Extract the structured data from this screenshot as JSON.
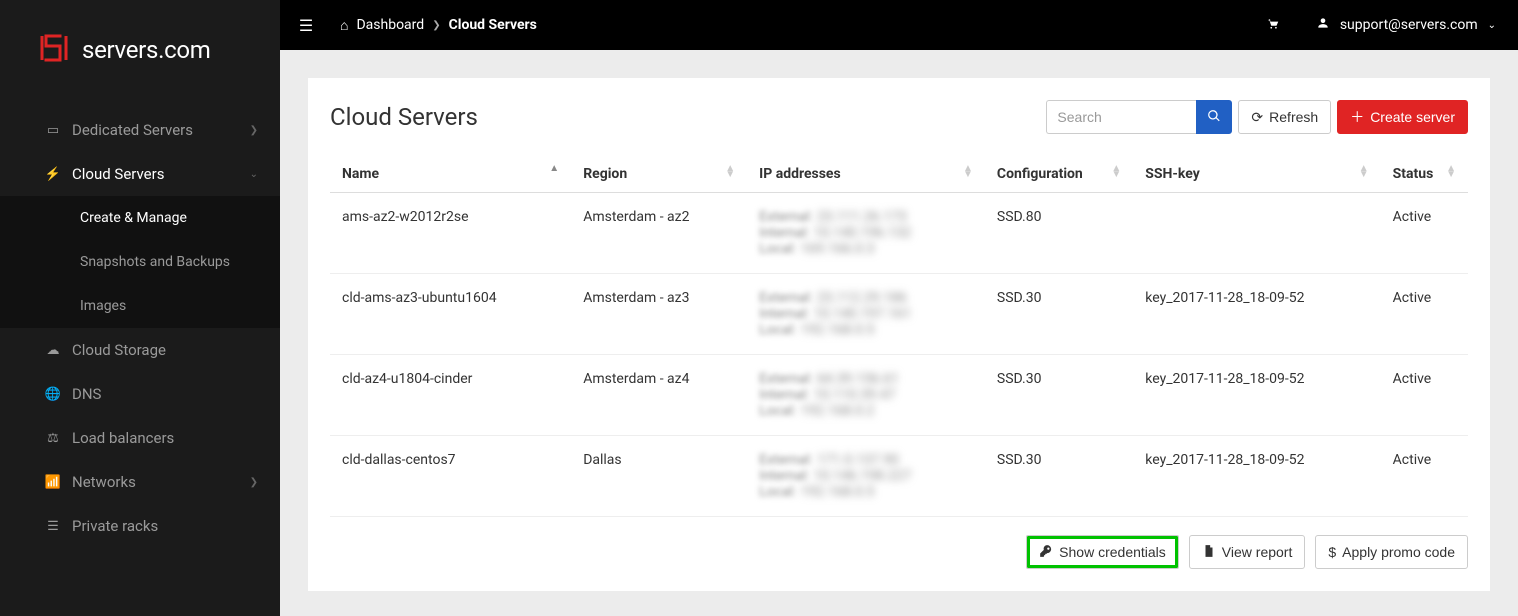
{
  "brand": {
    "text": "servers.com"
  },
  "topbar": {
    "crumb_root": "Dashboard",
    "crumb_current": "Cloud Servers",
    "user": "support@servers.com"
  },
  "sidebar": {
    "dedicated": "Dedicated Servers",
    "cloud_servers": "Cloud Servers",
    "sub_create": "Create & Manage",
    "sub_snapshots": "Snapshots and Backups",
    "sub_images": "Images",
    "cloud_storage": "Cloud Storage",
    "dns": "DNS",
    "load_balancers": "Load balancers",
    "networks": "Networks",
    "private_racks": "Private racks"
  },
  "panel": {
    "title": "Cloud Servers",
    "search_placeholder": "Search",
    "refresh": "Refresh",
    "create": "Create server"
  },
  "columns": {
    "name": "Name",
    "region": "Region",
    "ip": "IP addresses",
    "config": "Configuration",
    "sshkey": "SSH-key",
    "status": "Status"
  },
  "ip_labels": {
    "external": "External:",
    "internal": "Internal:",
    "local": "Local:"
  },
  "rows": [
    {
      "name": "ams-az2-w2012r2se",
      "region": "Amsterdam - az2",
      "ip_ext": "23.111.26.173",
      "ip_int": "10.140.196.132",
      "ip_loc": "169.166.0.3",
      "config": "SSD.80",
      "sshkey": "",
      "status": "Active"
    },
    {
      "name": "cld-ams-az3-ubuntu1604",
      "region": "Amsterdam - az3",
      "ip_ext": "23.112.29.186",
      "ip_int": "10.140.197.161",
      "ip_loc": "192.168.0.5",
      "config": "SSD.30",
      "sshkey": "key_2017-11-28_18-09-52",
      "status": "Active"
    },
    {
      "name": "cld-az4-u1804-cinder",
      "region": "Amsterdam - az4",
      "ip_ext": "64.39.156.61",
      "ip_int": "10.110.39.47",
      "ip_loc": "192.168.0.2",
      "config": "SSD.30",
      "sshkey": "key_2017-11-28_18-09-52",
      "status": "Active"
    },
    {
      "name": "cld-dallas-centos7",
      "region": "Dallas",
      "ip_ext": "171.0.137.90",
      "ip_int": "10.146.198.227",
      "ip_loc": "192.168.0.5",
      "config": "SSD.30",
      "sshkey": "key_2017-11-28_18-09-52",
      "status": "Active"
    }
  ],
  "footer": {
    "show_credentials": "Show credentials",
    "view_report": "View report",
    "apply_promo": "Apply promo code"
  }
}
